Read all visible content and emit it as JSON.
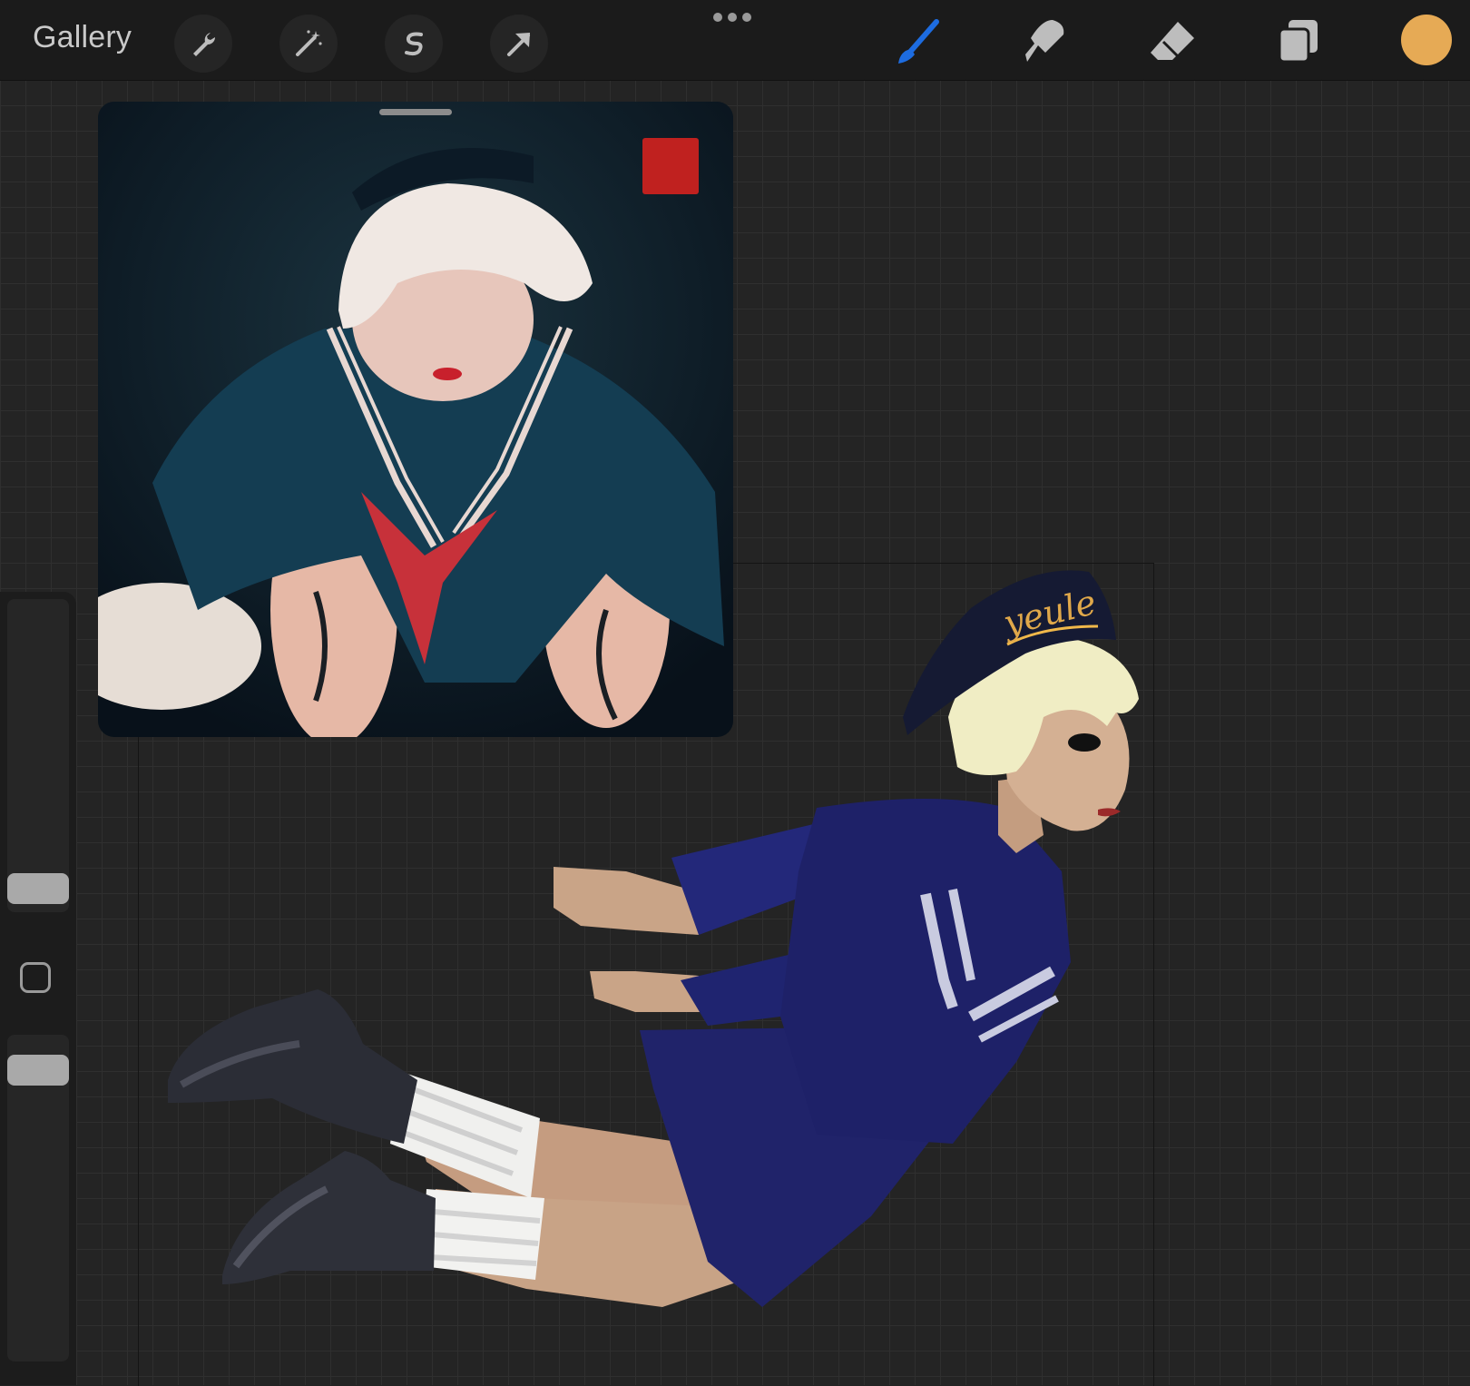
{
  "topbar": {
    "gallery_label": "Gallery",
    "left_tools": [
      "wrench-icon",
      "magic-wand-icon",
      "selection-icon",
      "transform-arrow-icon"
    ],
    "more_icon": "more-dots-icon",
    "right_tools": [
      "brush-icon",
      "smudge-icon",
      "eraser-icon",
      "layers-icon"
    ],
    "active_tool": "brush-icon",
    "current_color": "#e6aa55",
    "accent_color": "#1d6ce0"
  },
  "reference_window": {
    "visible": true
  },
  "sidebar": {
    "size_slider": "brush-size-slider",
    "opacity_slider": "brush-opacity-slider",
    "modify_button": "modify-square-button"
  },
  "artwork": {
    "hat_lettering": "yeule"
  }
}
